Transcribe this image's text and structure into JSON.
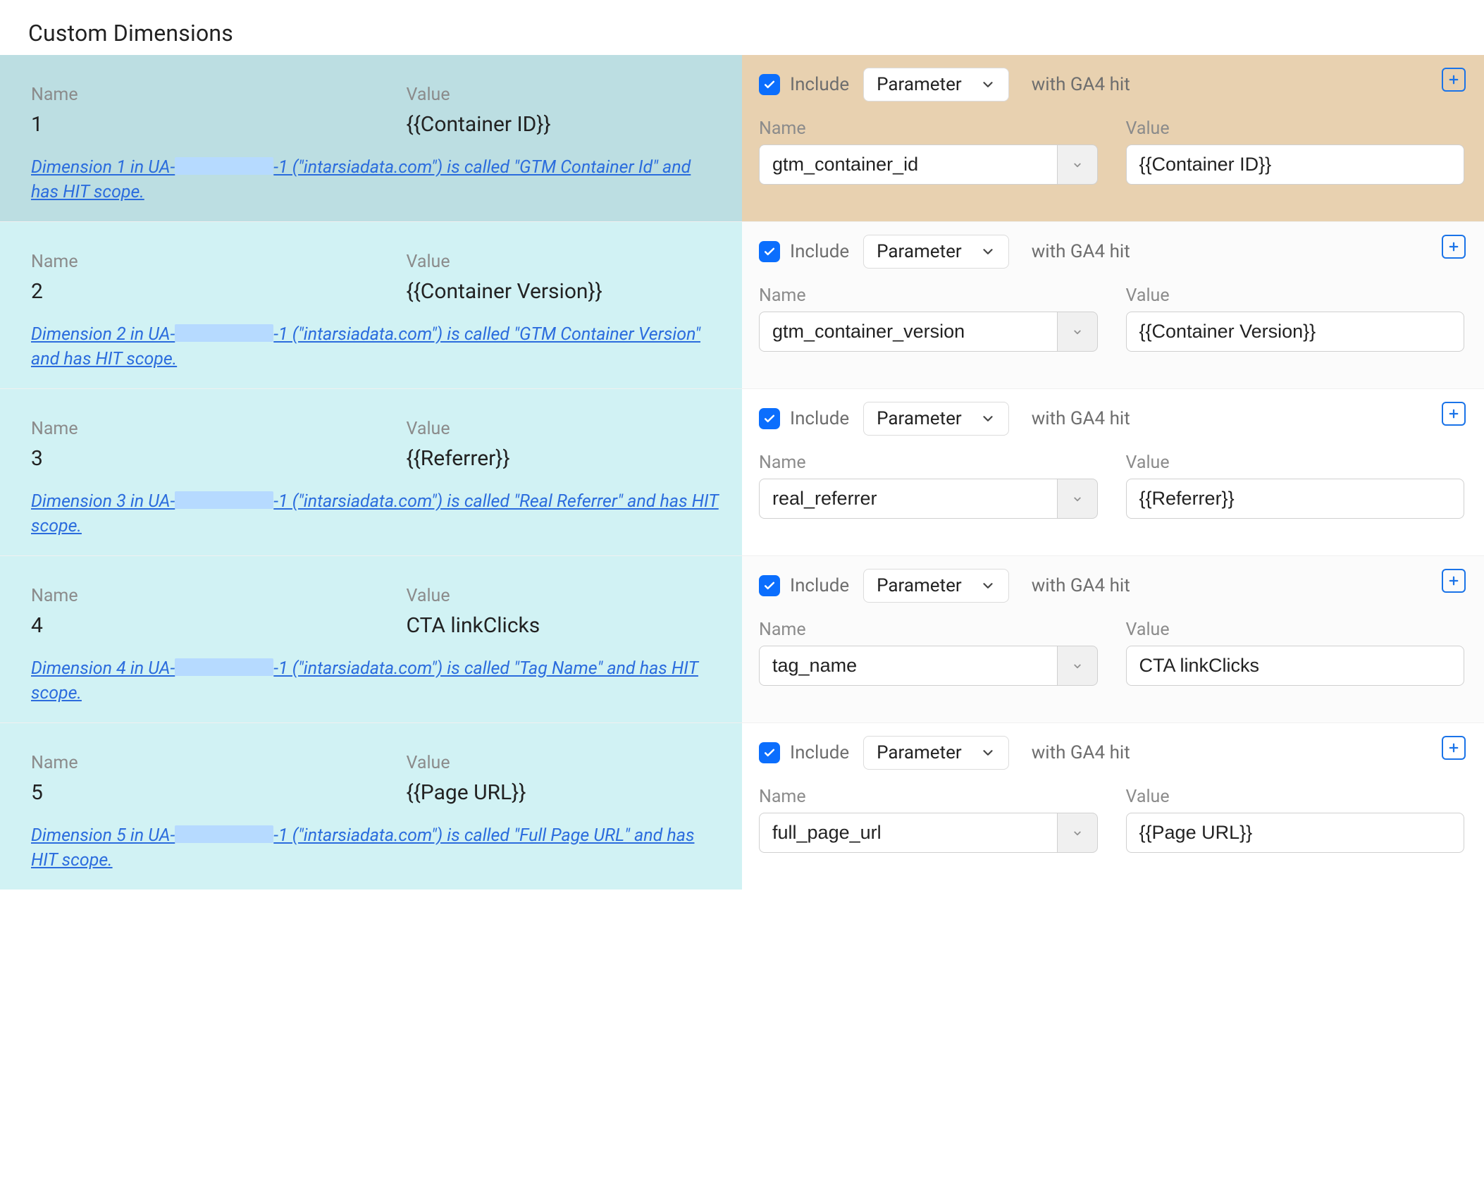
{
  "heading": "Custom Dimensions",
  "labels": {
    "name": "Name",
    "value": "Value",
    "include": "Include",
    "with_hit": "with GA4 hit",
    "param_type": "Parameter"
  },
  "rows": [
    {
      "selected": true,
      "left": {
        "name": "1",
        "value": "{{Container ID}}",
        "desc_a": "Dimension 1 in UA-",
        "desc_b": "-1 (\"intarsiadata.com\") is called \"GTM Container Id\" and has HIT scope."
      },
      "right": {
        "param_name": "gtm_container_id",
        "param_value": "{{Container ID}}"
      }
    },
    {
      "selected": false,
      "left": {
        "name": "2",
        "value": "{{Container Version}}",
        "desc_a": "Dimension 2 in UA-",
        "desc_b": "-1 (\"intarsiadata.com\") is called \"GTM Container Version\" and has HIT scope."
      },
      "right": {
        "param_name": "gtm_container_version",
        "param_value": "{{Container Version}}"
      }
    },
    {
      "selected": false,
      "left": {
        "name": "3",
        "value": "{{Referrer}}",
        "desc_a": "Dimension 3 in UA-",
        "desc_b": "-1 (\"intarsiadata.com\") is called \"Real Referrer\" and has HIT scope."
      },
      "right": {
        "param_name": "real_referrer",
        "param_value": "{{Referrer}}"
      }
    },
    {
      "selected": false,
      "left": {
        "name": "4",
        "value": "CTA linkClicks",
        "desc_a": "Dimension 4 in UA-",
        "desc_b": "-1 (\"intarsiadata.com\") is called \"Tag Name\" and has HIT scope."
      },
      "right": {
        "param_name": "tag_name",
        "param_value": "CTA linkClicks"
      }
    },
    {
      "selected": false,
      "left": {
        "name": "5",
        "value": "{{Page URL}}",
        "desc_a": "Dimension 5 in UA-",
        "desc_b": "-1 (\"intarsiadata.com\") is called \"Full Page URL\" and has HIT scope."
      },
      "right": {
        "param_name": "full_page_url",
        "param_value": "{{Page URL}}"
      }
    }
  ]
}
